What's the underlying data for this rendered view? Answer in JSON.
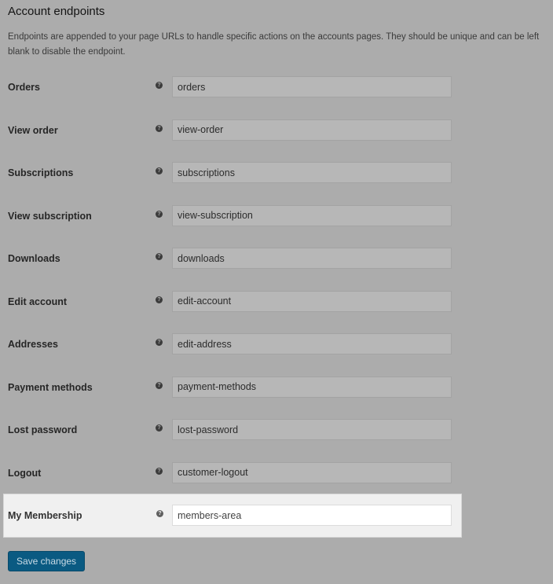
{
  "section": {
    "title": "Account endpoints",
    "description": "Endpoints are appended to your page URLs to handle specific actions on the accounts pages. They should be unique and can be left blank to disable the endpoint."
  },
  "help_icon_glyph": "?",
  "endpoints": [
    {
      "label": "Orders",
      "value": "orders"
    },
    {
      "label": "View order",
      "value": "view-order"
    },
    {
      "label": "Subscriptions",
      "value": "subscriptions"
    },
    {
      "label": "View subscription",
      "value": "view-subscription"
    },
    {
      "label": "Downloads",
      "value": "downloads"
    },
    {
      "label": "Edit account",
      "value": "edit-account"
    },
    {
      "label": "Addresses",
      "value": "edit-address"
    },
    {
      "label": "Payment methods",
      "value": "payment-methods"
    },
    {
      "label": "Lost password",
      "value": "lost-password"
    },
    {
      "label": "Logout",
      "value": "customer-logout"
    },
    {
      "label": "My Membership",
      "value": "members-area",
      "highlighted": true
    }
  ],
  "save_button": {
    "label": "Save changes",
    "color": "#0a5a82"
  }
}
